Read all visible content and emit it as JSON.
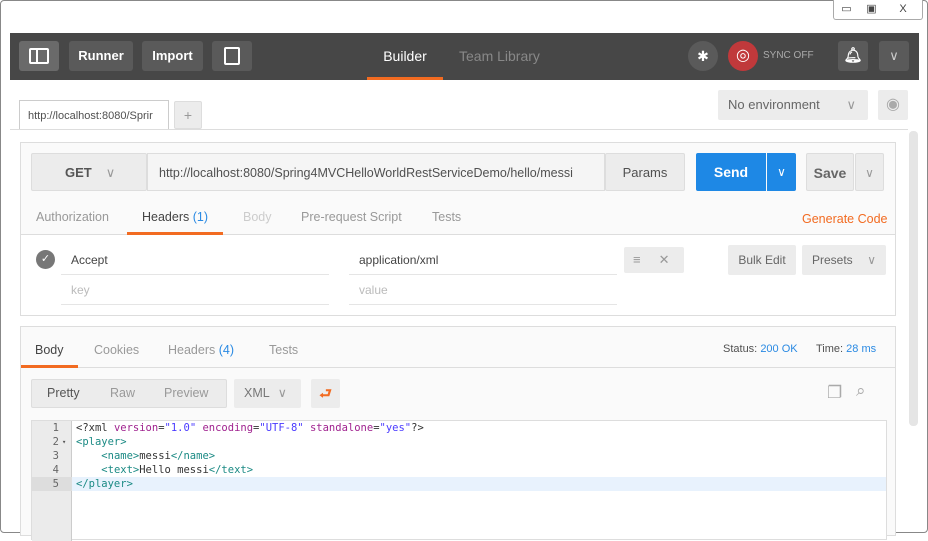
{
  "window": {
    "minimize": "▭",
    "maximize": "▣",
    "close": "X"
  },
  "toolbar": {
    "runner": "Runner",
    "import": "Import",
    "builder": "Builder",
    "team_library": "Team Library",
    "sync": "SYNC OFF"
  },
  "tabs": {
    "active": "http://localhost:8080/Sprir",
    "add": "+"
  },
  "environment": {
    "selected": "No environment"
  },
  "request": {
    "method": "GET",
    "url": "http://localhost:8080/Spring4MVCHelloWorldRestServiceDemo/hello/messi",
    "params": "Params",
    "send": "Send",
    "save": "Save",
    "tabs": [
      {
        "label": "Authorization"
      },
      {
        "label": "Headers",
        "count": "(1)"
      },
      {
        "label": "Body"
      },
      {
        "label": "Pre-request Script"
      },
      {
        "label": "Tests"
      }
    ],
    "generate_code": "Generate Code",
    "headers": [
      {
        "key": "Accept",
        "value": "application/xml"
      }
    ],
    "key_placeholder": "key",
    "value_placeholder": "value",
    "bulk_edit": "Bulk Edit",
    "presets": "Presets"
  },
  "response": {
    "tabs": [
      {
        "label": "Body"
      },
      {
        "label": "Cookies"
      },
      {
        "label": "Headers",
        "count": "(4)"
      },
      {
        "label": "Tests"
      }
    ],
    "status_label": "Status:",
    "status": "200 OK",
    "time_label": "Time:",
    "time": "28 ms",
    "views": [
      "Pretty",
      "Raw",
      "Preview"
    ],
    "format": "XML",
    "code": [
      {
        "n": "1",
        "text": "<?xml version=\"1.0\" encoding=\"UTF-8\" standalone=\"yes\"?>"
      },
      {
        "n": "2",
        "text": "<player>"
      },
      {
        "n": "3",
        "text": "    <name>messi</name>"
      },
      {
        "n": "4",
        "text": "    <text>Hello messi</text>"
      },
      {
        "n": "5",
        "text": "</player>"
      }
    ]
  },
  "colors": {
    "accent": "#f26b21",
    "send": "#1e88e5",
    "toolbar": "#474747",
    "sync": "#c0393b"
  }
}
